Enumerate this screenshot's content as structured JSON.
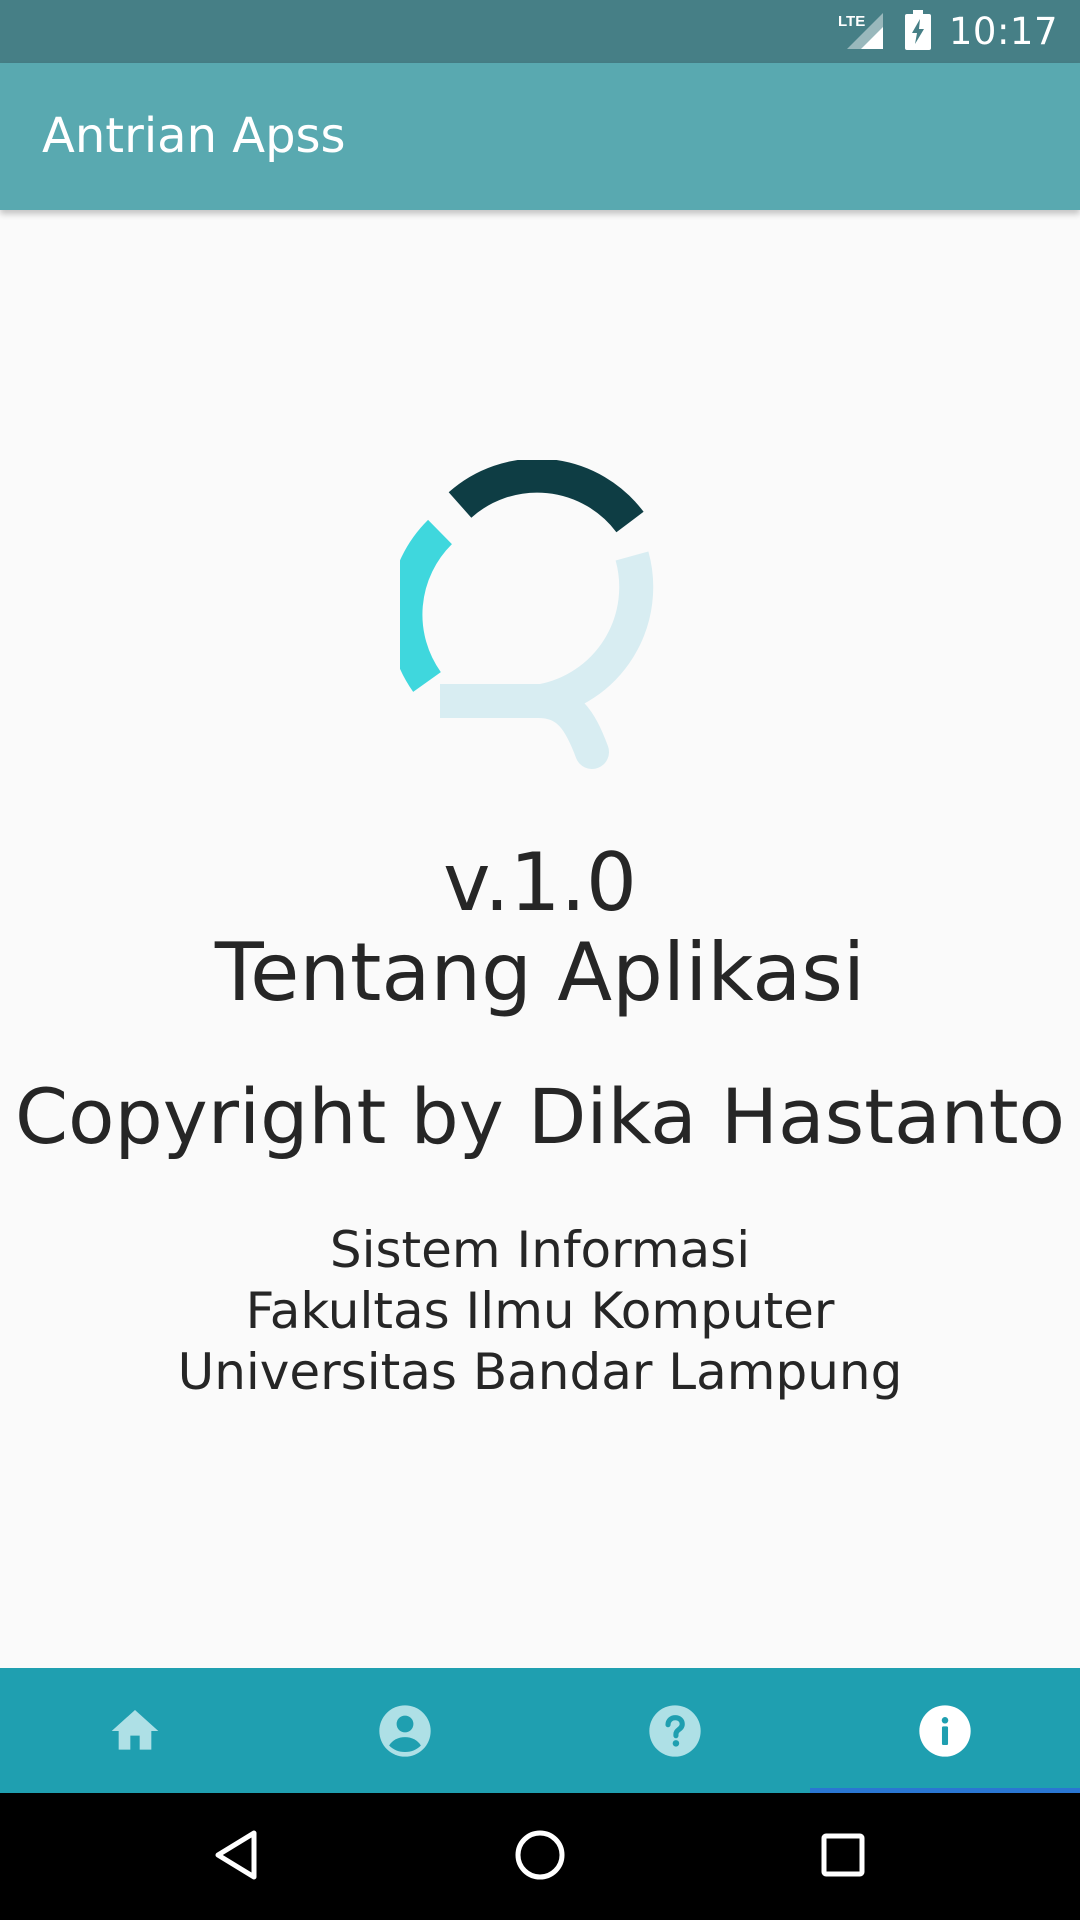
{
  "status_bar": {
    "time": "10:17",
    "network_label": "LTE",
    "icons": [
      "lte-signal-icon",
      "battery-charging-icon"
    ]
  },
  "app_bar": {
    "title": "Antrian Apss"
  },
  "content": {
    "version": "v.1.0",
    "about_title": "Tentang Aplikasi",
    "copyright": "Copyright by Dika Hastanto",
    "info_lines": [
      "Sistem Informasi",
      "Fakultas Ilmu Komputer",
      "Universitas Bandar Lampung"
    ]
  },
  "bottom_nav": {
    "tabs": [
      {
        "icon": "home-icon",
        "selected": false
      },
      {
        "icon": "account-icon",
        "selected": false
      },
      {
        "icon": "help-icon",
        "selected": false
      },
      {
        "icon": "info-icon",
        "selected": true
      }
    ]
  },
  "system_nav": {
    "buttons": [
      "back-icon",
      "home-circle-icon",
      "recents-icon"
    ]
  },
  "colors": {
    "status_bar": "#467f86",
    "app_bar": "#59a9b0",
    "bottom_nav": "#1f9fb0",
    "tab_inactive": "#aee0e6",
    "tab_active": "#ffffff",
    "tab_indicator": "#2a76d2",
    "text": "#262626",
    "logo_dark": "#0e3d44",
    "logo_cyan": "#3fd7dd",
    "logo_light": "#d8edf2"
  }
}
